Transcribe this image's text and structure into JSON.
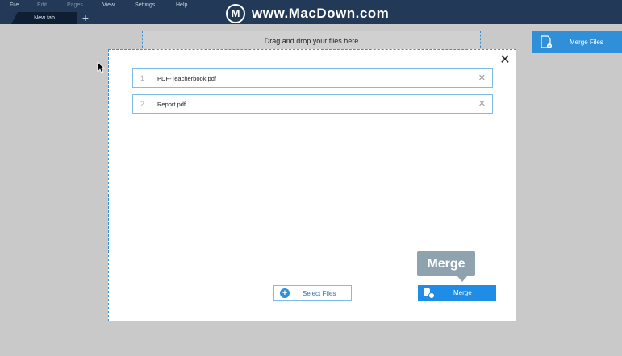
{
  "menu": {
    "items": [
      {
        "label": "File",
        "enabled": true
      },
      {
        "label": "Edit",
        "enabled": false
      },
      {
        "label": "Pages",
        "enabled": false
      },
      {
        "label": "View",
        "enabled": true
      },
      {
        "label": "Settings",
        "enabled": true
      },
      {
        "label": "Help",
        "enabled": true
      }
    ]
  },
  "tabs": {
    "active_label": "New tab",
    "add_label": "+"
  },
  "watermark": {
    "logo_letter": "M",
    "text": "www.MacDown.com"
  },
  "dropzone": {
    "text": "Drag and drop your files here"
  },
  "sidebar": {
    "merge_files_label": "Merge Files",
    "merge_files_icon": "document-merge-icon"
  },
  "modal": {
    "close_label": "✕",
    "files": [
      {
        "number": "1",
        "name": "PDF-Teacherbook.pdf",
        "remove": "✕"
      },
      {
        "number": "2",
        "name": "Report.pdf",
        "remove": "✕"
      }
    ],
    "select_files_label": "Select Files",
    "select_files_icon": "plus-circle-icon",
    "merge_label": "Merge",
    "merge_icon": "merge-icon",
    "tooltip": "Merge"
  },
  "colors": {
    "topbar": "#223a57",
    "accent": "#1f8ce6",
    "dashed_border": "#3a8fd4",
    "background": "#c9c9c9",
    "tooltip": "#8ea3ad"
  }
}
